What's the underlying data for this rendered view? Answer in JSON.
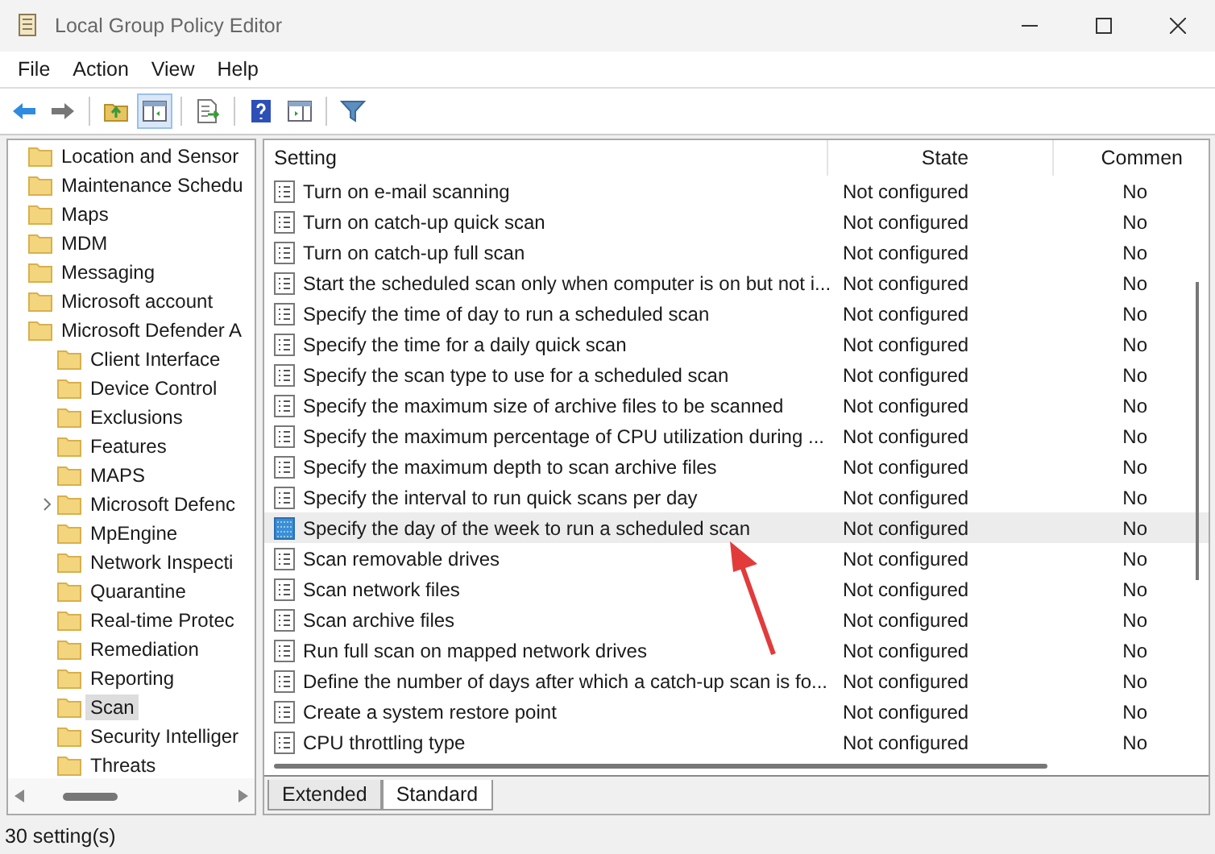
{
  "window": {
    "title": "Local Group Policy Editor"
  },
  "menu": [
    "File",
    "Action",
    "View",
    "Help"
  ],
  "toolbar": [
    {
      "kind": "back",
      "pressed": false
    },
    {
      "kind": "forward",
      "pressed": false
    },
    {
      "kind": "up",
      "pressed": false
    },
    {
      "kind": "tree",
      "pressed": true
    },
    {
      "kind": "export",
      "pressed": false
    },
    {
      "kind": "help",
      "pressed": false
    },
    {
      "kind": "pane",
      "pressed": false
    },
    {
      "kind": "filter",
      "pressed": false
    }
  ],
  "tree": [
    {
      "label": "Location and Sensor",
      "selected": false
    },
    {
      "label": "Maintenance Schedu",
      "selected": false
    },
    {
      "label": "Maps",
      "selected": false
    },
    {
      "label": "MDM",
      "selected": false
    },
    {
      "label": "Messaging",
      "selected": false
    },
    {
      "label": "Microsoft account",
      "selected": false
    },
    {
      "label": "Microsoft Defender A",
      "selected": false,
      "children": [
        {
          "label": "Client Interface",
          "selected": false
        },
        {
          "label": "Device Control",
          "selected": false
        },
        {
          "label": "Exclusions",
          "selected": false
        },
        {
          "label": "Features",
          "selected": false
        },
        {
          "label": "MAPS",
          "selected": false
        },
        {
          "label": "Microsoft Defenc",
          "selected": false,
          "expanded": false
        },
        {
          "label": "MpEngine",
          "selected": false
        },
        {
          "label": "Network Inspecti",
          "selected": false
        },
        {
          "label": "Quarantine",
          "selected": false
        },
        {
          "label": "Real-time Protec",
          "selected": false
        },
        {
          "label": "Remediation",
          "selected": false
        },
        {
          "label": "Reporting",
          "selected": false
        },
        {
          "label": "Scan",
          "selected": true
        },
        {
          "label": "Security Intelliger",
          "selected": false
        },
        {
          "label": "Threats",
          "selected": false
        }
      ]
    }
  ],
  "table": {
    "columns": [
      "Setting",
      "State",
      "Commen"
    ],
    "rows": [
      {
        "setting": "Turn on e-mail scanning",
        "state": "Not configured",
        "comment": "No",
        "selected": false
      },
      {
        "setting": "Turn on catch-up quick scan",
        "state": "Not configured",
        "comment": "No",
        "selected": false
      },
      {
        "setting": "Turn on catch-up full scan",
        "state": "Not configured",
        "comment": "No",
        "selected": false
      },
      {
        "setting": "Start the scheduled scan only when computer is on but not i...",
        "state": "Not configured",
        "comment": "No",
        "selected": false
      },
      {
        "setting": "Specify the time of day to run a scheduled scan",
        "state": "Not configured",
        "comment": "No",
        "selected": false
      },
      {
        "setting": "Specify the time for a daily quick scan",
        "state": "Not configured",
        "comment": "No",
        "selected": false
      },
      {
        "setting": "Specify the scan type to use for a scheduled scan",
        "state": "Not configured",
        "comment": "No",
        "selected": false
      },
      {
        "setting": "Specify the maximum size of archive files to be scanned",
        "state": "Not configured",
        "comment": "No",
        "selected": false
      },
      {
        "setting": "Specify the maximum percentage of CPU utilization during ...",
        "state": "Not configured",
        "comment": "No",
        "selected": false
      },
      {
        "setting": "Specify the maximum depth to scan archive files",
        "state": "Not configured",
        "comment": "No",
        "selected": false
      },
      {
        "setting": "Specify the interval to run quick scans per day",
        "state": "Not configured",
        "comment": "No",
        "selected": false
      },
      {
        "setting": "Specify the day of the week to run a scheduled scan",
        "state": "Not configured",
        "comment": "No",
        "selected": true
      },
      {
        "setting": "Scan removable drives",
        "state": "Not configured",
        "comment": "No",
        "selected": false
      },
      {
        "setting": "Scan network files",
        "state": "Not configured",
        "comment": "No",
        "selected": false
      },
      {
        "setting": "Scan archive files",
        "state": "Not configured",
        "comment": "No",
        "selected": false
      },
      {
        "setting": "Run full scan on mapped network drives",
        "state": "Not configured",
        "comment": "No",
        "selected": false
      },
      {
        "setting": "Define the number of days after which a catch-up scan is fo...",
        "state": "Not configured",
        "comment": "No",
        "selected": false
      },
      {
        "setting": "Create a system restore point",
        "state": "Not configured",
        "comment": "No",
        "selected": false
      },
      {
        "setting": "CPU throttling type",
        "state": "Not configured",
        "comment": "No",
        "selected": false
      }
    ]
  },
  "tabs": [
    {
      "label": "Extended",
      "selected": false
    },
    {
      "label": "Standard",
      "selected": true
    }
  ],
  "status_bar": "30 setting(s)"
}
